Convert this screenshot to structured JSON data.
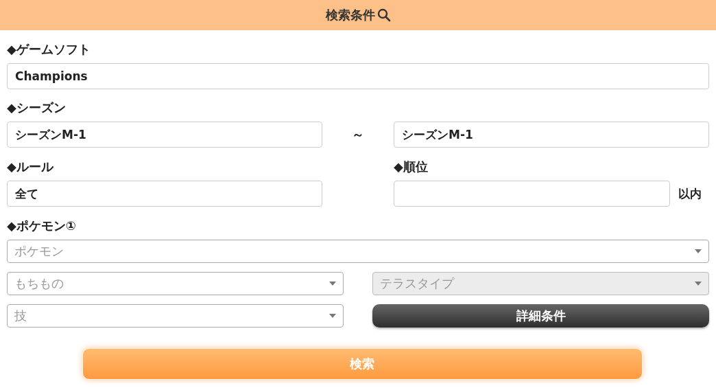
{
  "header": {
    "title": "検索条件"
  },
  "game_soft": {
    "label": "◆ゲームソフト",
    "value": "Champions"
  },
  "season": {
    "label": "◆シーズン",
    "from": "シーズンM-1",
    "separator": "～",
    "to": "シーズンM-1"
  },
  "rule": {
    "label": "◆ルール",
    "value": "全て"
  },
  "rank": {
    "label": "◆順位",
    "suffix": "以内"
  },
  "pokemon": {
    "label": "◆ポケモン①",
    "selects": [
      {
        "placeholder": "ポケモン",
        "disabled": false
      },
      {
        "placeholder": "もちもの",
        "disabled": false
      },
      {
        "placeholder": "テラスタイプ",
        "disabled": true
      },
      {
        "placeholder": "技",
        "disabled": false
      }
    ]
  },
  "detail_button": "詳細条件",
  "search_button": "検索"
}
